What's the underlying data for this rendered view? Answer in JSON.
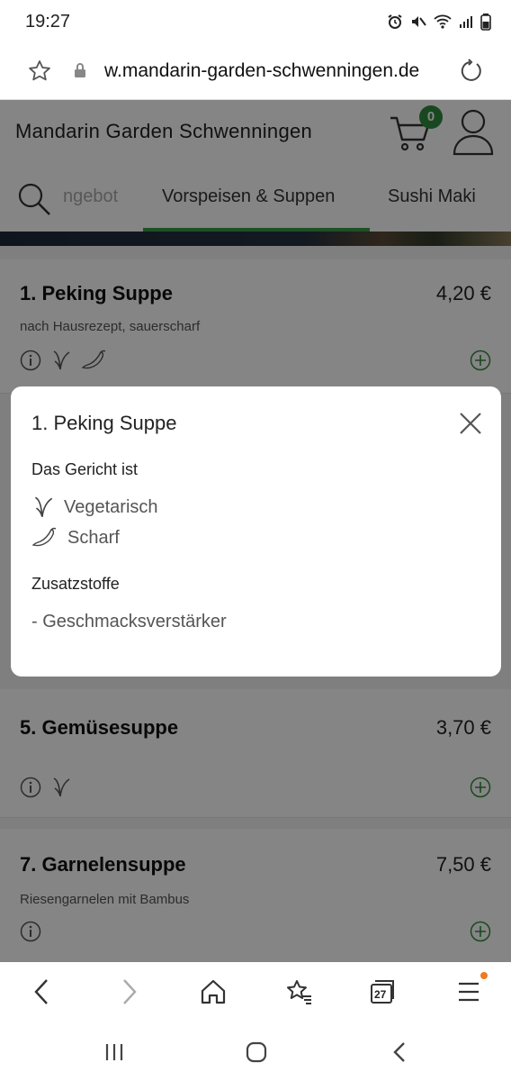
{
  "status": {
    "time": "19:27"
  },
  "browser": {
    "url": "w.mandarin-garden-schwenningen.de",
    "tab_count": "27"
  },
  "site": {
    "title": "Mandarin Garden Schwenningen",
    "cart_count": "0"
  },
  "tabs": [
    {
      "label": "ngebot"
    },
    {
      "label": "Vorspeisen & Suppen"
    },
    {
      "label": "Sushi Maki"
    }
  ],
  "menu": [
    {
      "name": "1. Peking Suppe",
      "price": "4,20 €",
      "description": "nach Hausrezept, sauerscharf",
      "icons": [
        "info-icon",
        "vegetarian-icon",
        "spicy-icon"
      ]
    },
    {
      "name": "5. Gemüsesuppe",
      "price": "3,70 €",
      "description": "",
      "icons": [
        "info-icon",
        "vegetarian-icon"
      ]
    },
    {
      "name": "7. Garnelensuppe",
      "price": "7,50 €",
      "description": "Riesengarnelen mit Bambus",
      "icons": [
        "info-icon"
      ]
    }
  ],
  "modal": {
    "title": "1. Peking Suppe",
    "dish_is_label": "Das Gericht ist",
    "properties": [
      {
        "label": "Vegetarisch",
        "icon": "vegetarian-icon"
      },
      {
        "label": "Scharf",
        "icon": "spicy-icon"
      }
    ],
    "additives_label": "Zusatzstoffe",
    "additives": [
      "- Geschmacksverstärker"
    ]
  },
  "colors": {
    "accent_green": "#2e8b3e",
    "notification_orange": "#f07a20"
  }
}
